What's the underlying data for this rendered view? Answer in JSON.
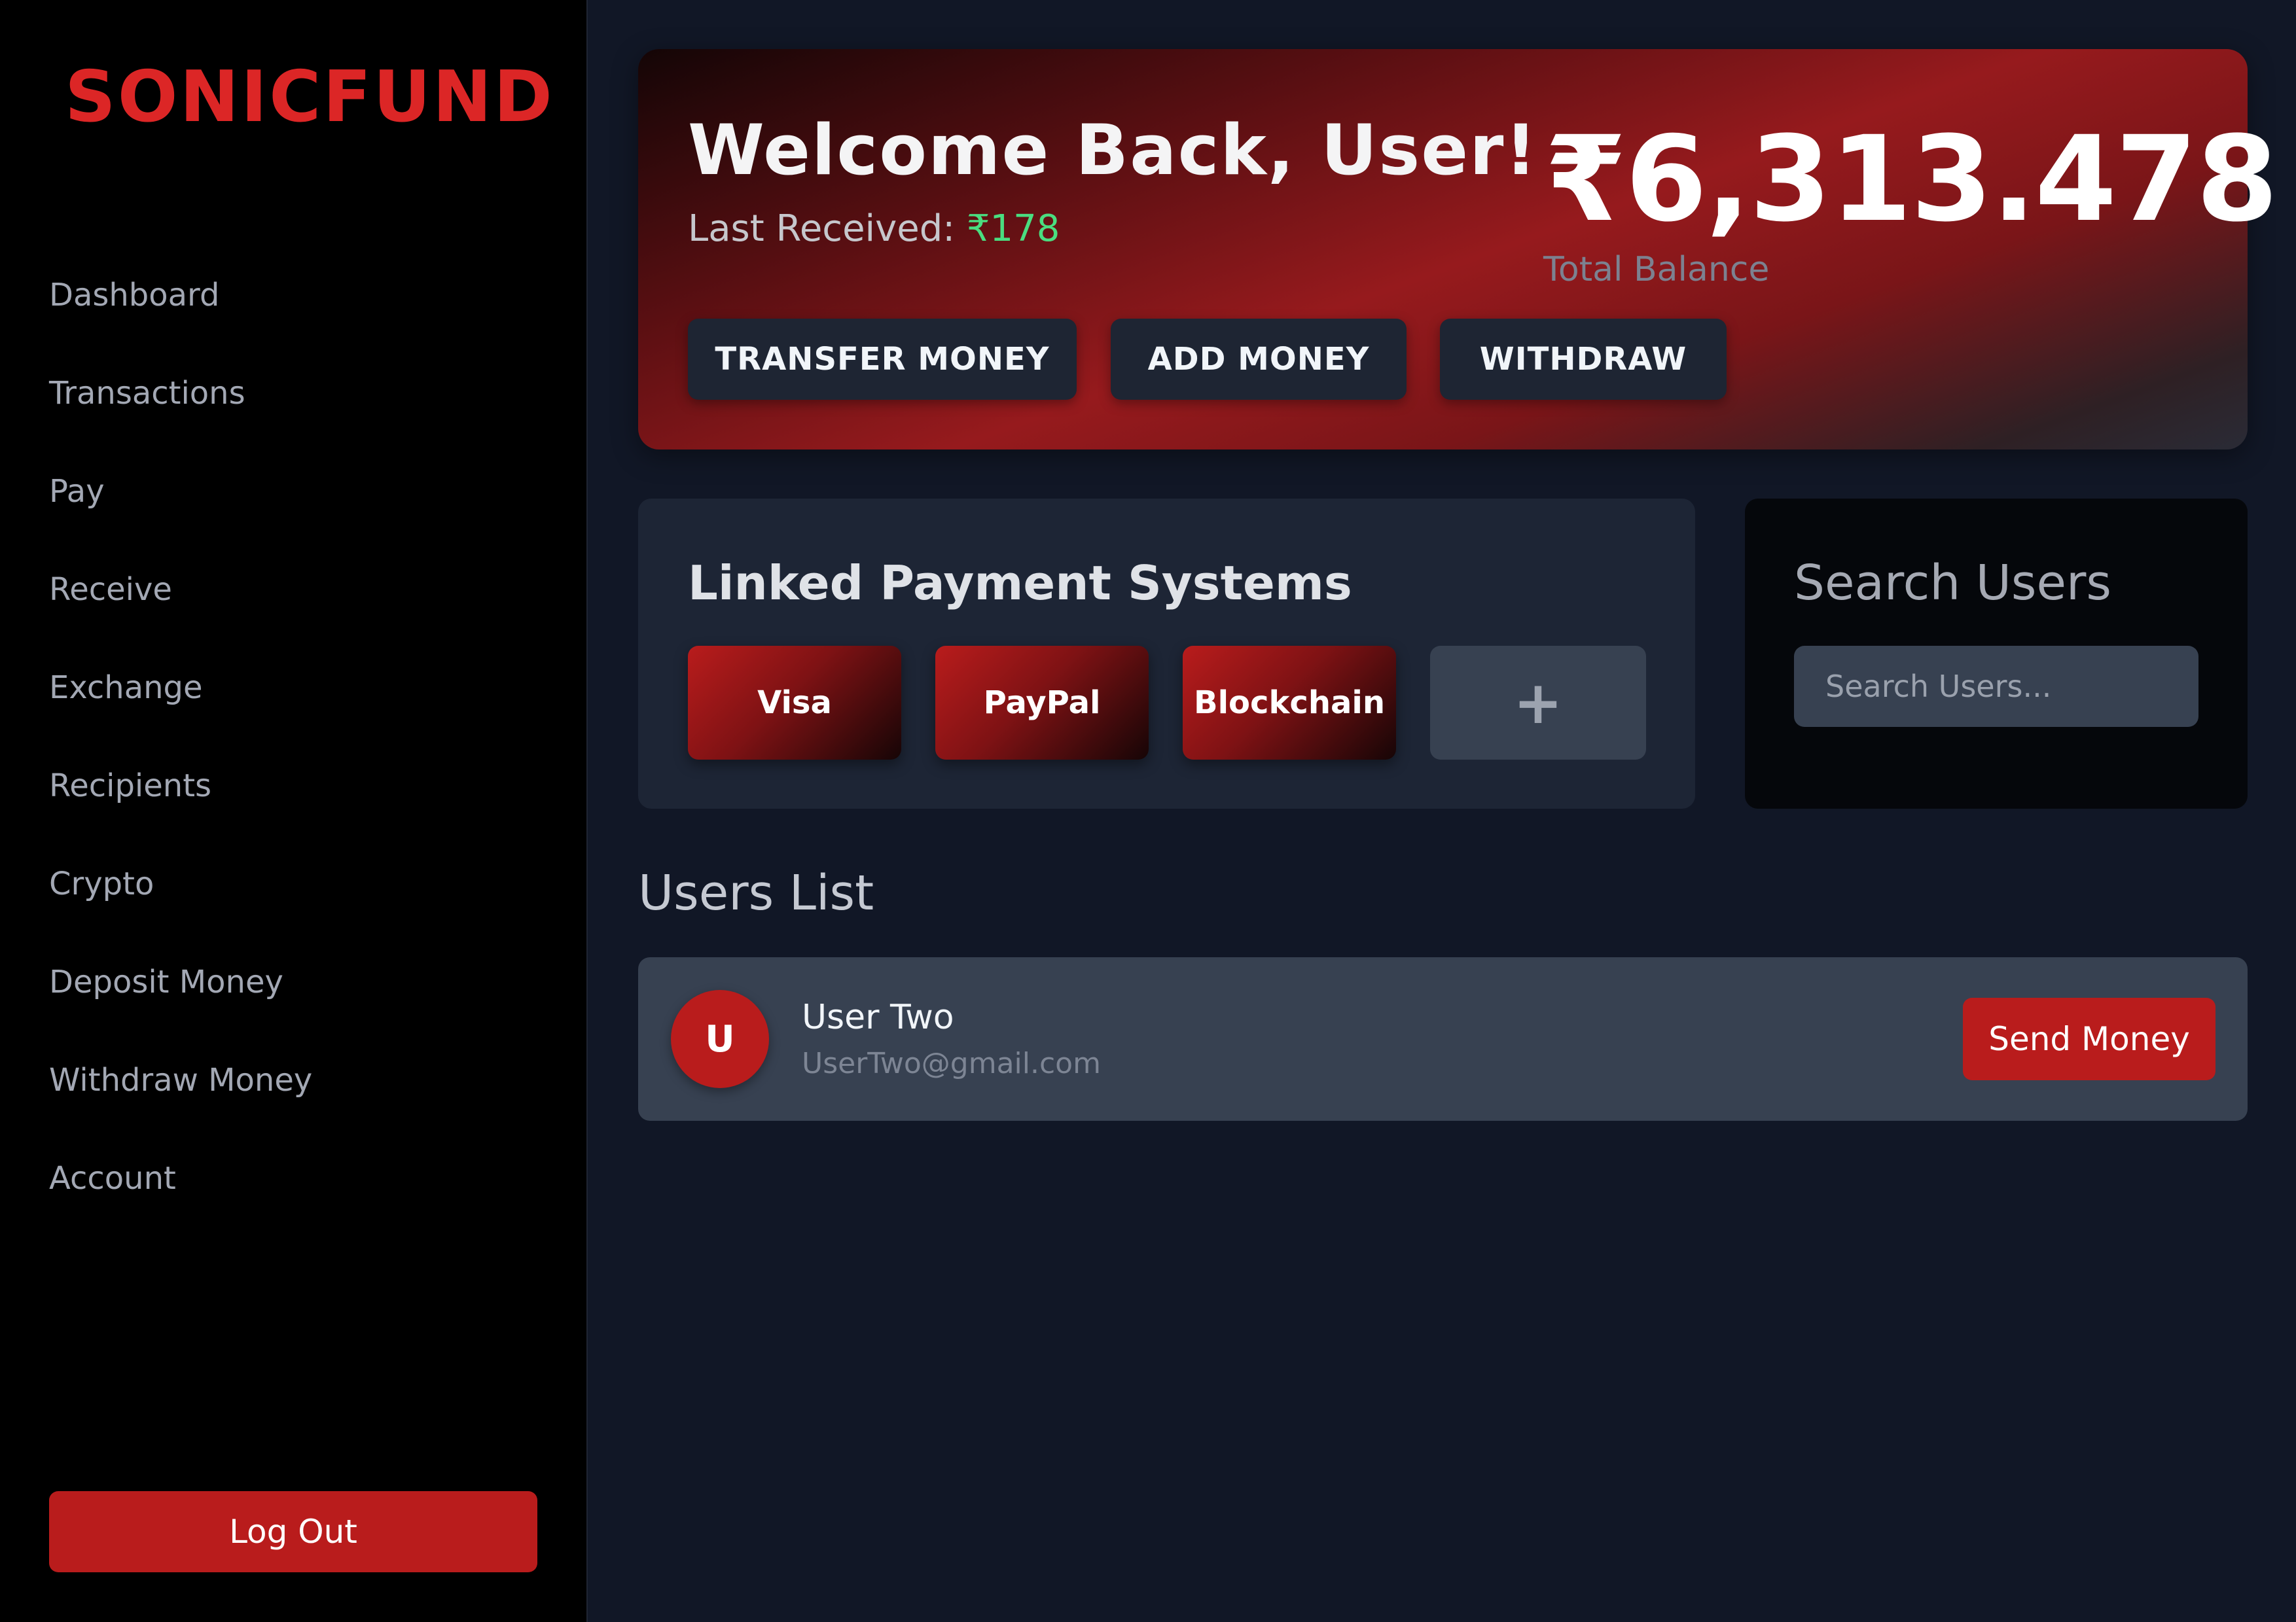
{
  "sidebar": {
    "logo": "SONICFUND",
    "nav_items": [
      {
        "label": "Dashboard"
      },
      {
        "label": "Transactions"
      },
      {
        "label": "Pay"
      },
      {
        "label": "Receive"
      },
      {
        "label": "Exchange"
      },
      {
        "label": "Recipients"
      },
      {
        "label": "Crypto"
      },
      {
        "label": "Deposit Money"
      },
      {
        "label": "Withdraw Money"
      },
      {
        "label": "Account"
      }
    ],
    "logout_label": "Log Out"
  },
  "hero": {
    "title": "Welcome Back, User!",
    "last_received_label": "Last Received:",
    "last_received_amount": "₹178",
    "balance": "₹6,313.478",
    "balance_label": "Total Balance",
    "actions": [
      {
        "label": "TRANSFER MONEY"
      },
      {
        "label": "ADD MONEY"
      },
      {
        "label": "WITHDRAW"
      }
    ]
  },
  "linked_payments": {
    "title": "Linked Payment Systems",
    "systems": [
      {
        "label": "Visa"
      },
      {
        "label": "PayPal"
      },
      {
        "label": "Blockchain"
      }
    ],
    "add_label": "+"
  },
  "search": {
    "title": "Search Users",
    "placeholder": "Search Users...",
    "value": ""
  },
  "users_list": {
    "title": "Users List",
    "users": [
      {
        "initial": "U",
        "name": "User Two",
        "email": "UserTwo@gmail.com",
        "action_label": "Send Money"
      }
    ]
  },
  "colors": {
    "accent": "#b91c1c",
    "logo": "#dc2626",
    "positive": "#4ade80",
    "background": "#111726",
    "sidebar": "#000000"
  }
}
